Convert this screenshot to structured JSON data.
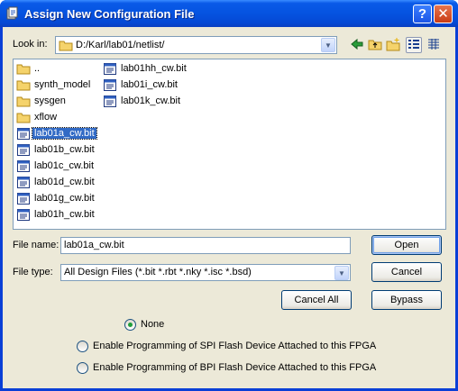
{
  "window": {
    "title": "Assign New Configuration File",
    "help_glyph": "?",
    "close_glyph": "✕"
  },
  "lookin": {
    "label": "Look in:",
    "path": "D:/Karl/lab01/netlist/"
  },
  "files": [
    {
      "name": "..",
      "kind": "folder"
    },
    {
      "name": "synth_model",
      "kind": "folder"
    },
    {
      "name": "sysgen",
      "kind": "folder"
    },
    {
      "name": "xflow",
      "kind": "folder"
    },
    {
      "name": "lab01a_cw.bit",
      "kind": "bit",
      "selected": true
    },
    {
      "name": "lab01b_cw.bit",
      "kind": "bit"
    },
    {
      "name": "lab01c_cw.bit",
      "kind": "bit"
    },
    {
      "name": "lab01d_cw.bit",
      "kind": "bit"
    },
    {
      "name": "lab01g_cw.bit",
      "kind": "bit"
    },
    {
      "name": "lab01h_cw.bit",
      "kind": "bit"
    },
    {
      "name": "lab01hh_cw.bit",
      "kind": "bit"
    },
    {
      "name": "lab01i_cw.bit",
      "kind": "bit"
    },
    {
      "name": "lab01k_cw.bit",
      "kind": "bit"
    }
  ],
  "filename": {
    "label": "File name:",
    "value": "lab01a_cw.bit"
  },
  "filetype": {
    "label": "File type:",
    "value": "All Design Files (*.bit *.rbt *.nky *.isc *.bsd)"
  },
  "buttons": {
    "open": "Open",
    "cancel": "Cancel",
    "cancel_all": "Cancel All",
    "bypass": "Bypass"
  },
  "options": [
    {
      "label": "None",
      "checked": true
    },
    {
      "label": "Enable Programming of SPI Flash Device Attached to this FPGA",
      "checked": false
    },
    {
      "label": "Enable Programming of BPI Flash Device Attached to this FPGA",
      "checked": false
    }
  ]
}
